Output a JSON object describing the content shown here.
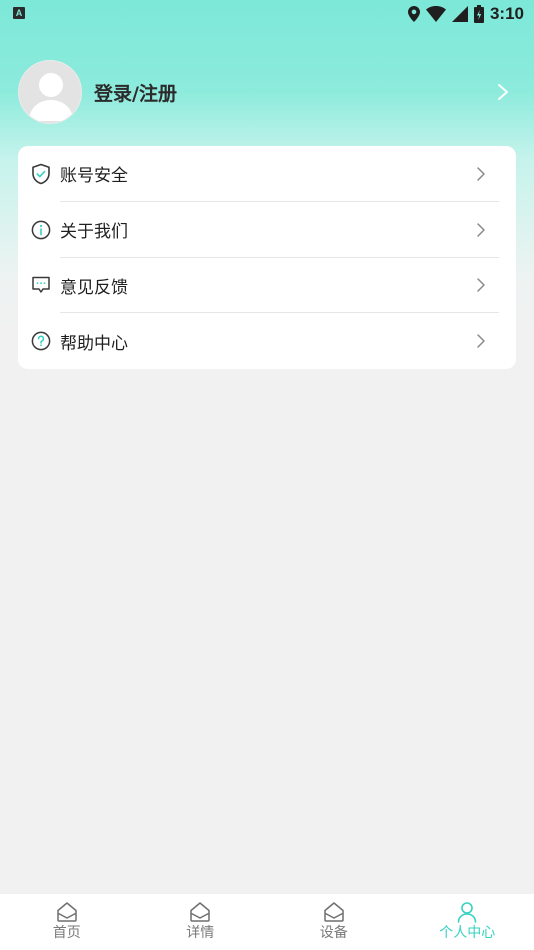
{
  "status_bar": {
    "notification_icon": "A",
    "time": "3:10",
    "icons": [
      "location-icon",
      "wifi-icon",
      "signal-icon",
      "battery-icon"
    ]
  },
  "profile": {
    "login_label": "登录/注册",
    "avatar_icon": "default-avatar-icon",
    "arrow_icon": "chevron-right-icon"
  },
  "menu": {
    "items": [
      {
        "label": "账号安全",
        "icon": "shield-check-icon"
      },
      {
        "label": "关于我们",
        "icon": "info-icon"
      },
      {
        "label": "意见反馈",
        "icon": "feedback-chat-icon"
      },
      {
        "label": "帮助中心",
        "icon": "help-icon"
      }
    ]
  },
  "bottom_nav": {
    "items": [
      {
        "label": "首页",
        "icon": "home-icon",
        "active": false
      },
      {
        "label": "详情",
        "icon": "home-icon",
        "active": false
      },
      {
        "label": "设备",
        "icon": "home-icon",
        "active": false
      },
      {
        "label": "个人中心",
        "icon": "person-icon",
        "active": true
      }
    ]
  },
  "colors": {
    "accent": "#36d2c0",
    "header_top": "#7de8d8",
    "background": "#f1f1f1",
    "icon_stroke": "#3a3a3a"
  }
}
